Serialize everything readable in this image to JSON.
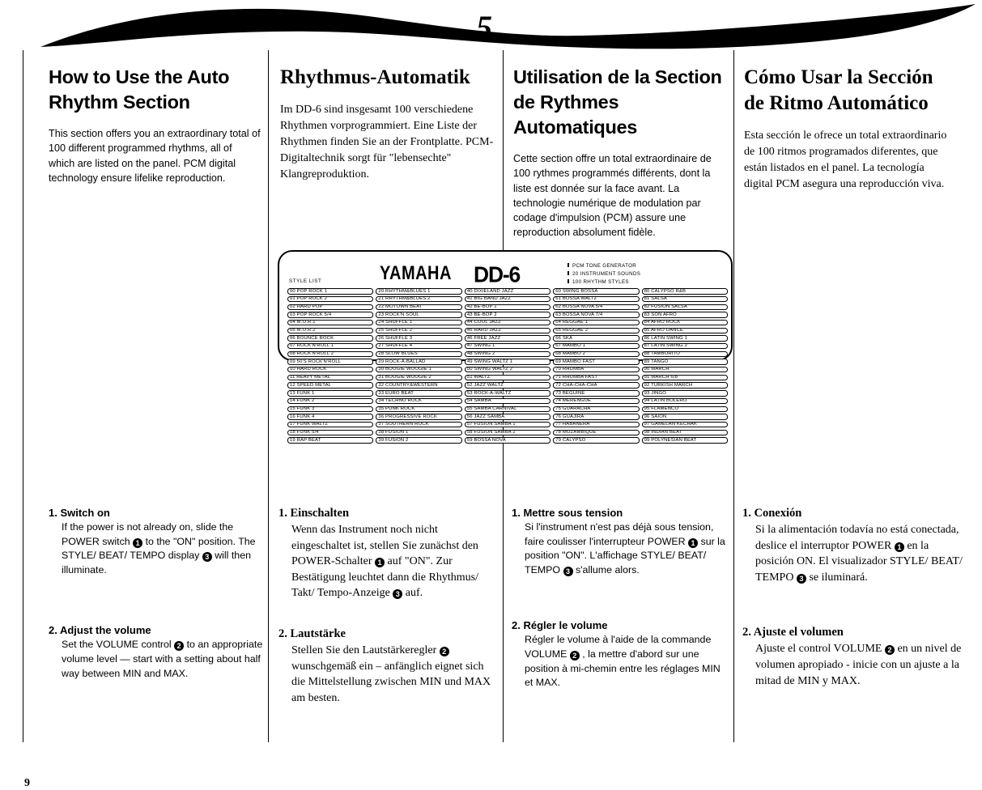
{
  "page": {
    "chapter_number": "5",
    "page_number": "9"
  },
  "columns": [
    {
      "lang": "en",
      "heading": "How to Use the Auto Rhythm Section",
      "intro": "This section offers you an extraordinary total of 100 different programmed rhythms, all of which are listed on the panel. PCM digital technology ensure lifelike reproduction."
    },
    {
      "lang": "de",
      "heading": "Rhythmus-Automatik",
      "intro": "Im DD-6 sind insgesamt 100 verschiedene Rhythmen vorprogrammiert. Eine Liste der Rhythmen finden Sie an der Frontplatte. PCM-Digitaltechnik sorgt für \"lebensechte\" Klangreproduktion."
    },
    {
      "lang": "fr",
      "heading": "Utilisation de la Section de Rythmes Automatiques",
      "intro": "Cette section offre un total extraordinaire de 100 rythmes programmés différents, dont la liste est donnée sur la face avant. La technologie numérique de modulation par codage d'impulsion (PCM) assure une reproduction absolument fidèle."
    },
    {
      "lang": "es",
      "heading": "Cómo Usar la Sección de Ritmo Automático",
      "intro": "Esta sección le ofrece un total extraordinario de 100 ritmos programados diferentes, que están listados en el panel. La tecnología digital PCM asegura una reproducción viva."
    }
  ],
  "panel": {
    "style_list_label": "STYLE LIST",
    "brand": "YAMAHA",
    "model": "DD-6",
    "specs": [
      "PCM TONE GENERATOR",
      "20 INSTRUMENT SOUNDS",
      "100 RHYTHM STYLES"
    ],
    "style_columns": [
      [
        "00 POP ROCK 1",
        "01 POP ROCK 2",
        "02 HARD POP",
        "03 POP ROCK 5/4",
        "04 M.O.R.1",
        "05 M.O.R.2",
        "06 BOUNCE ROCK",
        "07 ROCK'N'ROLL 1",
        "08 ROCK'N'ROLL 2",
        "09 50'S ROCK'N'ROLL",
        "10 HARD ROCK",
        "11 HEAVY METAL",
        "12 SPEED METAL",
        "13 FUNK 1",
        "14 FUNK 2",
        "15 FUNK 3",
        "16 FUNK 4",
        "17 FUNK WALTZ",
        "18 FUNK 5/4",
        "19 RAP BEAT"
      ],
      [
        "20 RHYTHM&BLUES 1",
        "21 RHYTHM&BLUES 2",
        "22 MOTOWN BEAT",
        "23 ROCK'N SOUL",
        "24 SHUFFLE 1",
        "25 SHUFFLE 2",
        "26 SHUFFLE 3",
        "27 SHUFFLE 4",
        "28 SLOW BLUES",
        "29 ROCK-A-BALLAD",
        "30 BOOGIE WOOGIE 1",
        "31 BOOGIE WOOGIE 2",
        "32 COUNTRY&WESTERN",
        "33 EURO BEAT",
        "34 TECHNO ROCK",
        "35 PUNK ROCK",
        "36 PROGRESSIVE ROCK",
        "37 SOUTHERN ROCK",
        "38 FUSION 1",
        "39 FUSION 2"
      ],
      [
        "40 DIXIELAND JAZZ",
        "41 BIG BAND JAZZ",
        "42 BE-BOP 1",
        "43 BE-BOP 2",
        "44 COOL JAZZ",
        "45 HARD JAZZ",
        "46 FREE JAZZ",
        "47 SWING 1",
        "48 SWING 2",
        "49 SWING WALTZ 1",
        "50 SWING WALTZ 2",
        "51 WALTZ",
        "52 JAZZ WALTZ",
        "53 ROCK-A-WALTZ",
        "54 SAMBA",
        "55 SAMBA CARNIVAL",
        "56 JAZZ SAMBA",
        "57 FUSION SAMBA 1",
        "58 FUSION SAMBA 2",
        "59 BOSSA NOVA"
      ],
      [
        "60 SWING BOSSA",
        "61 BOSSA WALTZ",
        "62 BOSSA NOVA 5/4",
        "63 BOSSA NOVA 7/4",
        "64 REGGAE 1",
        "65 REGGAE 2",
        "66 SKA",
        "67 MAMBO 1",
        "68 MAMBO 2",
        "69 MAMBO FAST",
        "70 RHUMBA",
        "71 RHUMBA FAST",
        "72 CHA-CHA-CHA",
        "73 BEGUINE",
        "74 MERENGUE",
        "75 GUARACHA",
        "76 GUAJIRA",
        "77 HABANERA",
        "78 MOZAMBIQUE",
        "79 CALYPSO"
      ],
      [
        "80 CALYPSO R&B",
        "81 SALSA",
        "82 FUSION SALSA",
        "83 SON AFRO",
        "84 AFRO ROCK",
        "85 AFRO DANCE",
        "86 LATIN SWING 1",
        "87 LATIN SWING 2",
        "88 TAMBORITO",
        "89 TANGO",
        "90 MARCH",
        "91 MARCH 6/8",
        "92 TURKISH MARCH",
        "93 JINGO",
        "94 LATIN BOLERO",
        "95 FLAMENCO",
        "96 SAION",
        "97 GAMELAN KECHAK",
        "98 INDIAN BEAT",
        "99 POLYNESIAN BEAT"
      ]
    ]
  },
  "instructions": [
    {
      "lang": "en",
      "steps": [
        {
          "title": "1. Switch on",
          "body_parts": [
            "If the power is not already on, slide the POWER switch ",
            "1",
            " to the \"ON\" position. The STYLE/ BEAT/ TEMPO display ",
            "3",
            " will then illuminate."
          ]
        },
        {
          "title": "2. Adjust the volume",
          "body_parts": [
            "Set the VOLUME control ",
            "2",
            " to an appropriate volume level — start with a setting about half way between MIN and MAX."
          ]
        }
      ]
    },
    {
      "lang": "de",
      "steps": [
        {
          "title": "1. Einschalten",
          "body_parts": [
            "Wenn das Instrument noch nicht eingeschaltet ist, stellen Sie zunächst den POWER-Schalter ",
            "1",
            " auf \"ON\". Zur Bestätigung leuchtet dann die Rhythmus/ Takt/ Tempo-Anzeige ",
            "3",
            " auf."
          ]
        },
        {
          "title": "2. Lautstärke",
          "body_parts": [
            "Stellen Sie den Lautstärkeregler ",
            "2",
            " wunschgemäß ein – anfänglich eignet sich die Mittelstellung zwischen MIN und MAX am besten."
          ]
        }
      ]
    },
    {
      "lang": "fr",
      "steps": [
        {
          "title": "1. Mettre sous tension",
          "body_parts": [
            "Si l'instrument n'est pas déjà sous tension, faire coulisser l'interrupteur POWER ",
            "1",
            " sur la position \"ON\". L'affichage STYLE/ BEAT/ TEMPO ",
            "3",
            " s'allume alors."
          ]
        },
        {
          "title": "2. Régler le volume",
          "body_parts": [
            "Régler le volume à l'aide de la commande VOLUME ",
            "2",
            " , la mettre d'abord sur une position à mi-chemin entre les réglages MIN et MAX."
          ]
        }
      ]
    },
    {
      "lang": "es",
      "steps": [
        {
          "title": "1. Conexión",
          "body_parts": [
            "Si la alimentación todavía no está conectada, deslice el interruptor POWER ",
            "1",
            " en la posición ON. El visualizador STYLE/ BEAT/ TEMPO ",
            "3",
            " se iluminará."
          ]
        },
        {
          "title": "2. Ajuste el volumen",
          "body_parts": [
            "Ajuste el control VOLUME ",
            "2",
            " en un nivel de volumen apropiado - inicie con un ajuste a la mitad de MIN y MAX."
          ]
        }
      ]
    }
  ]
}
